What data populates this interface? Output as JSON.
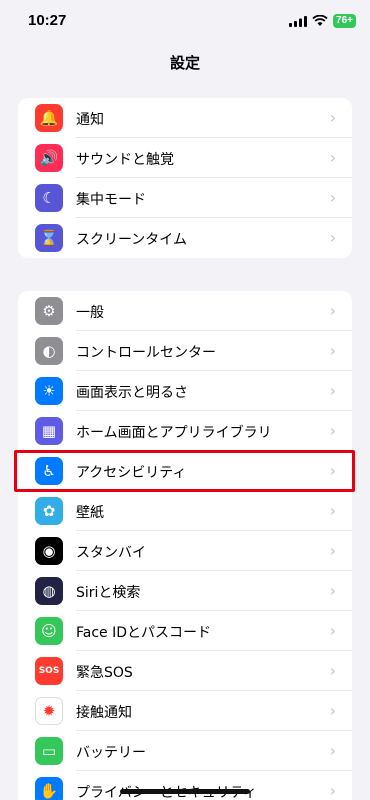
{
  "status": {
    "time": "10:27",
    "battery": "76+"
  },
  "title": "設定",
  "group1": [
    {
      "label": "通知",
      "icon": "bell-icon",
      "color": "#ff3b30",
      "glyph": "🔔"
    },
    {
      "label": "サウンドと触覚",
      "icon": "speaker-icon",
      "color": "#ff2d55",
      "glyph": "🔊"
    },
    {
      "label": "集中モード",
      "icon": "moon-icon",
      "color": "#5856d6",
      "glyph": "☾"
    },
    {
      "label": "スクリーンタイム",
      "icon": "hourglass-icon",
      "color": "#5856d6",
      "glyph": "⌛"
    }
  ],
  "group2": [
    {
      "label": "一般",
      "icon": "gear-icon",
      "color": "#8e8e93",
      "glyph": "⚙"
    },
    {
      "label": "コントロールセンター",
      "icon": "toggles-icon",
      "color": "#8e8e93",
      "glyph": "◐"
    },
    {
      "label": "画面表示と明るさ",
      "icon": "brightness-icon",
      "color": "#007aff",
      "glyph": "☀"
    },
    {
      "label": "ホーム画面とアプリライブラリ",
      "icon": "app-grid-icon",
      "color": "#5e5ce6",
      "glyph": "▦"
    },
    {
      "label": "アクセシビリティ",
      "icon": "accessibility-icon",
      "color": "#007aff",
      "glyph": "♿"
    },
    {
      "label": "壁紙",
      "icon": "flower-icon",
      "color": "#32ade6",
      "glyph": "✿"
    },
    {
      "label": "スタンバイ",
      "icon": "standby-icon",
      "color": "#000000",
      "glyph": "◉"
    },
    {
      "label": "Siriと検索",
      "icon": "siri-icon",
      "color": "#222244",
      "glyph": "◍"
    },
    {
      "label": "Face IDとパスコード",
      "icon": "face-id-icon",
      "color": "#34c759",
      "glyph": "☺"
    },
    {
      "label": "緊急SOS",
      "icon": "sos-icon",
      "color": "#ff3b30",
      "glyph": "SOS"
    },
    {
      "label": "接触通知",
      "icon": "exposure-icon",
      "color": "#ffffff",
      "glyph": "✹"
    },
    {
      "label": "バッテリー",
      "icon": "battery-icon",
      "color": "#34c759",
      "glyph": "▭"
    },
    {
      "label": "プライバシーとセキュリティ",
      "icon": "hand-icon",
      "color": "#007aff",
      "glyph": "✋"
    }
  ]
}
